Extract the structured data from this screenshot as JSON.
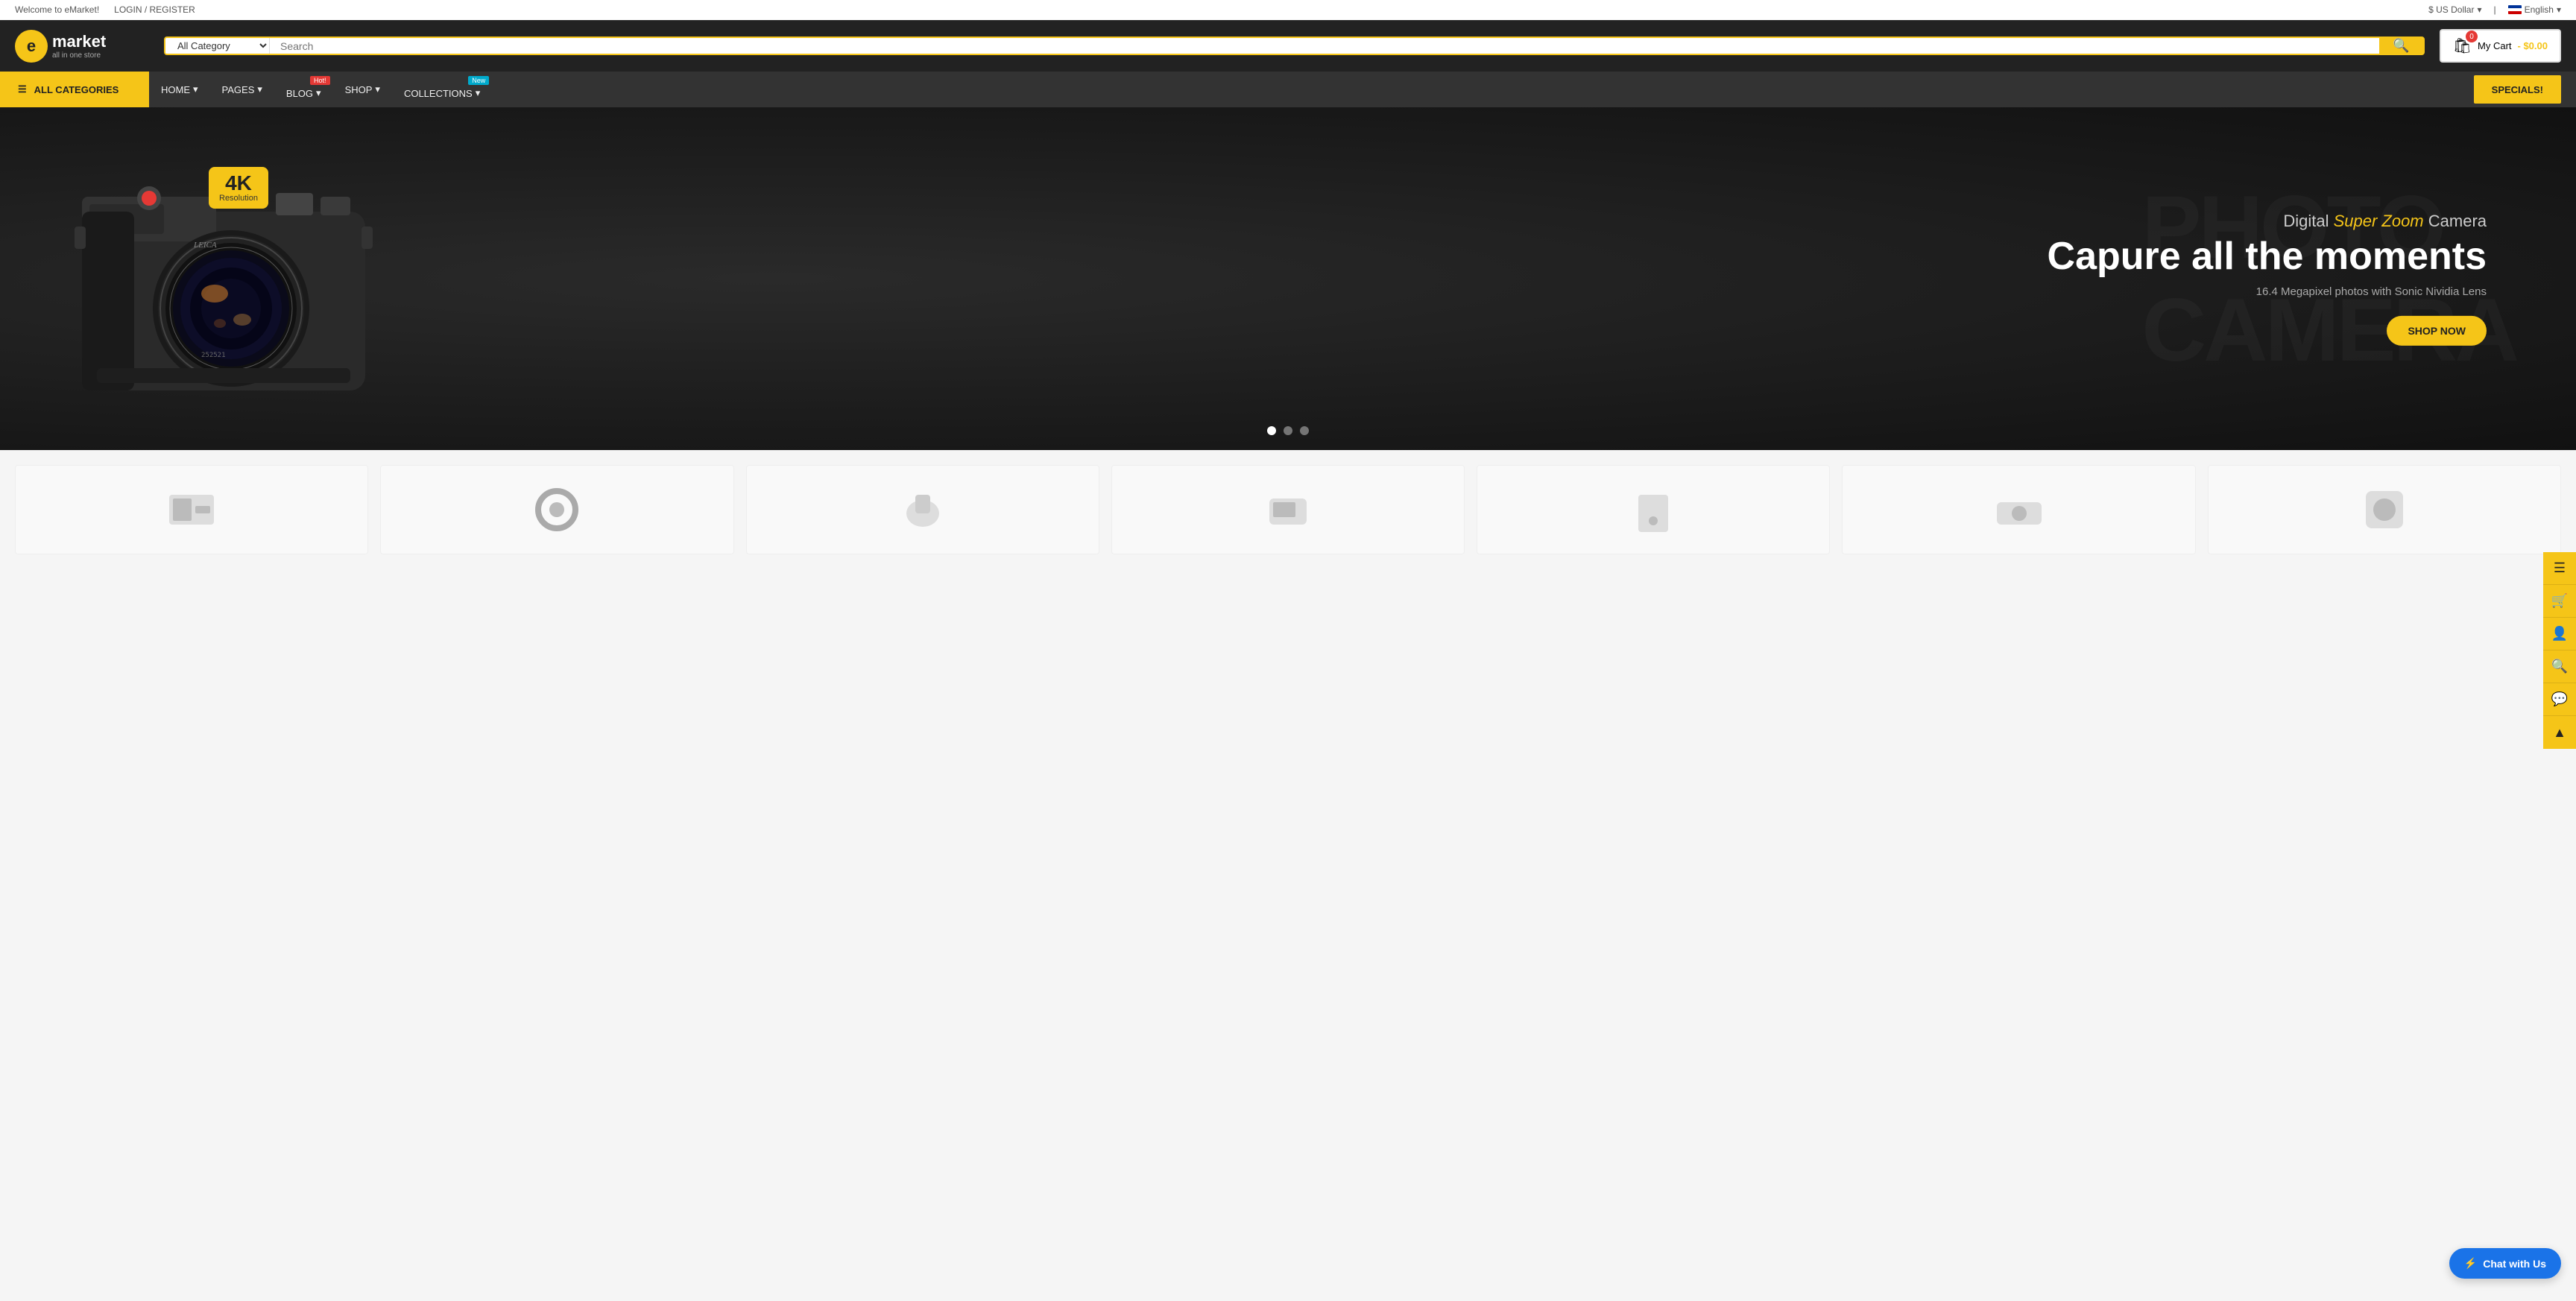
{
  "topbar": {
    "welcome": "Welcome to eMarket!",
    "login": "LOGIN / REGISTER",
    "currency": "$ US Dollar",
    "language": "English"
  },
  "header": {
    "logo_letter": "e",
    "logo_name": "market",
    "logo_tagline": "all in one store",
    "search_placeholder": "Search",
    "category_default": "All Category",
    "cart_label": "My Cart",
    "cart_price": "- $0.00",
    "cart_count": "0"
  },
  "nav": {
    "all_categories": "ALL CATEGORIES",
    "items": [
      {
        "label": "HOME",
        "badge": null
      },
      {
        "label": "PAGES",
        "badge": null
      },
      {
        "label": "BLOG",
        "badge": "Hot!"
      },
      {
        "label": "SHOP",
        "badge": null
      },
      {
        "label": "COLLECTIONS",
        "badge": "New"
      }
    ],
    "specials": "SPECIALS!"
  },
  "hero": {
    "badge_4k": "4K",
    "badge_res": "Resolution",
    "subtitle_pre": "Digital ",
    "subtitle_highlight": "Super Zoom",
    "subtitle_post": " Camera",
    "title": "Capure all the moments",
    "description": "16.4 Megapixel photos with Sonic Nividia Lens",
    "cta": "SHOP NOW",
    "watermark": "PHOTO CAMERA",
    "dots": [
      true,
      false,
      false
    ]
  },
  "sidebar_icons": [
    {
      "name": "menu-icon",
      "symbol": "☰"
    },
    {
      "name": "cart-icon",
      "symbol": "🛒"
    },
    {
      "name": "user-icon",
      "symbol": "👤"
    },
    {
      "name": "search-icon",
      "symbol": "🔍"
    },
    {
      "name": "chat-icon",
      "symbol": "💬"
    },
    {
      "name": "scroll-top-icon",
      "symbol": "▲"
    }
  ],
  "chat": {
    "label": "Chat with Us"
  }
}
